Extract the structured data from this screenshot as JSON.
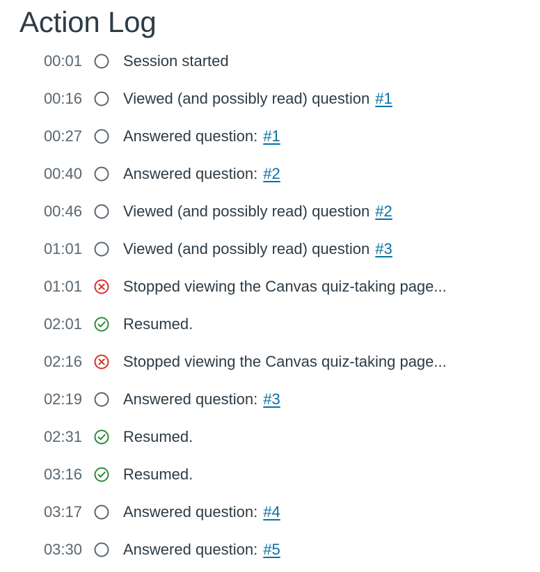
{
  "title": "Action Log",
  "colors": {
    "text": "#2d3b45",
    "time": "#5a6670",
    "link": "#0770a3",
    "neutral": "#5a6670",
    "stopped": "#d93025",
    "resumed": "#2f8a3a"
  },
  "entries": [
    {
      "time": "00:01",
      "status": "circle-icon",
      "text": "Session started",
      "link": ""
    },
    {
      "time": "00:16",
      "status": "circle-icon",
      "text": "Viewed (and possibly read) question",
      "link": "#1"
    },
    {
      "time": "00:27",
      "status": "circle-icon",
      "text": "Answered question:",
      "link": "#1"
    },
    {
      "time": "00:40",
      "status": "circle-icon",
      "text": "Answered question:",
      "link": "#2"
    },
    {
      "time": "00:46",
      "status": "circle-icon",
      "text": "Viewed (and possibly read) question",
      "link": "#2"
    },
    {
      "time": "01:01",
      "status": "circle-icon",
      "text": "Viewed (and possibly read) question",
      "link": "#3"
    },
    {
      "time": "01:01",
      "status": "x-circle-icon",
      "text": "Stopped viewing the Canvas quiz-taking page...",
      "link": ""
    },
    {
      "time": "02:01",
      "status": "check-circle-icon",
      "text": "Resumed.",
      "link": ""
    },
    {
      "time": "02:16",
      "status": "x-circle-icon",
      "text": "Stopped viewing the Canvas quiz-taking page...",
      "link": ""
    },
    {
      "time": "02:19",
      "status": "circle-icon",
      "text": "Answered question:",
      "link": "#3"
    },
    {
      "time": "02:31",
      "status": "check-circle-icon",
      "text": "Resumed.",
      "link": ""
    },
    {
      "time": "03:16",
      "status": "check-circle-icon",
      "text": "Resumed.",
      "link": ""
    },
    {
      "time": "03:17",
      "status": "circle-icon",
      "text": "Answered question:",
      "link": "#4"
    },
    {
      "time": "03:30",
      "status": "circle-icon",
      "text": "Answered question:",
      "link": "#5"
    }
  ]
}
